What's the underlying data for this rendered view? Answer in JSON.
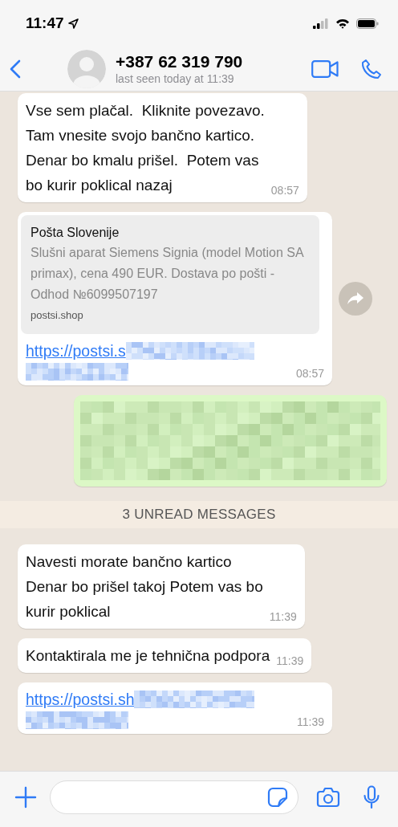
{
  "status_bar": {
    "time": "11:47"
  },
  "header": {
    "contact": "+387 62 319 790",
    "subtitle": "last seen today at 11:39"
  },
  "messages": [
    {
      "kind": "text",
      "outgoing": false,
      "text": "Vse sem plačal.  Kliknite povezavo.\nTam vnesite svojo bančno kartico.\nDenar bo kmalu prišel.  Potem vas\nbo kurir poklical nazaj",
      "time": "08:57"
    },
    {
      "kind": "link_preview",
      "outgoing": false,
      "preview": {
        "title": "Pošta Slovenije",
        "description": "Slušni aparat Siemens Signia (model Motion SA primax), cena 490 EUR. Dostava po pošti - Odhod №6099507197",
        "domain": "postsi.shop"
      },
      "link": "https://postsi.s",
      "time": "08:57"
    },
    {
      "kind": "redacted",
      "outgoing": true
    },
    {
      "kind": "unread_divider",
      "text": "3 UNREAD MESSAGES"
    },
    {
      "kind": "text",
      "outgoing": false,
      "text": "Navesti morate bančno kartico\nDenar bo prišel takoj Potem vas bo\nkurir poklical",
      "time": "11:39"
    },
    {
      "kind": "text",
      "outgoing": false,
      "text": "Kontaktirala me je tehnična podpora",
      "time": "11:39"
    },
    {
      "kind": "link",
      "outgoing": false,
      "link": "https://postsi.sh",
      "time": "11:39"
    }
  ]
}
